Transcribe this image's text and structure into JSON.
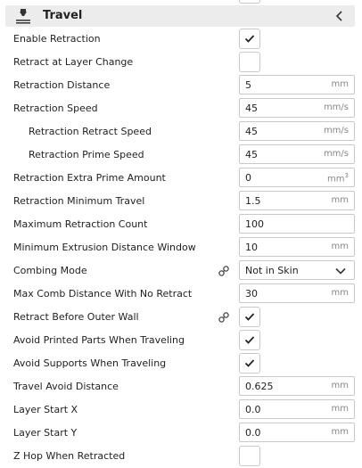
{
  "section": {
    "title": "Travel",
    "icon": "travel-nozzle-icon",
    "collapse_icon": "chevron-left-icon"
  },
  "settings": [
    {
      "label": "Enable Retraction",
      "type": "checkbox",
      "checked": true
    },
    {
      "label": "Retract at Layer Change",
      "type": "checkbox",
      "checked": false
    },
    {
      "label": "Retraction Distance",
      "type": "number",
      "value": "5",
      "unit": "mm"
    },
    {
      "label": "Retraction Speed",
      "type": "number",
      "value": "45",
      "unit": "mm/s"
    },
    {
      "label": "Retraction Retract Speed",
      "type": "number",
      "value": "45",
      "unit": "mm/s",
      "indent": true
    },
    {
      "label": "Retraction Prime Speed",
      "type": "number",
      "value": "45",
      "unit": "mm/s",
      "indent": true
    },
    {
      "label": "Retraction Extra Prime Amount",
      "type": "number",
      "value": "0",
      "unit": "mm",
      "unit_sup": "3"
    },
    {
      "label": "Retraction Minimum Travel",
      "type": "number",
      "value": "1.5",
      "unit": "mm"
    },
    {
      "label": "Maximum Retraction Count",
      "type": "number",
      "value": "100",
      "unit": ""
    },
    {
      "label": "Minimum Extrusion Distance Window",
      "type": "number",
      "value": "10",
      "unit": "mm"
    },
    {
      "label": "Combing Mode",
      "type": "select",
      "value": "Not in Skin",
      "linked": true
    },
    {
      "label": "Max Comb Distance With No Retract",
      "type": "number",
      "value": "30",
      "unit": "mm"
    },
    {
      "label": "Retract Before Outer Wall",
      "type": "checkbox",
      "checked": true,
      "linked": true
    },
    {
      "label": "Avoid Printed Parts When Traveling",
      "type": "checkbox",
      "checked": true
    },
    {
      "label": "Avoid Supports When Traveling",
      "type": "checkbox",
      "checked": true
    },
    {
      "label": "Travel Avoid Distance",
      "type": "number",
      "value": "0.625",
      "unit": "mm"
    },
    {
      "label": "Layer Start X",
      "type": "number",
      "value": "0.0",
      "unit": "mm"
    },
    {
      "label": "Layer Start Y",
      "type": "number",
      "value": "0.0",
      "unit": "mm"
    },
    {
      "label": "Z Hop When Retracted",
      "type": "checkbox",
      "checked": false
    }
  ],
  "colors": {
    "header_bg": "#ececec",
    "border": "#c9c9c9",
    "unit": "#888888"
  }
}
